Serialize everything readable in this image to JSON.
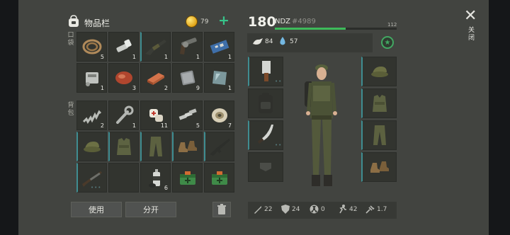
{
  "inventory": {
    "title": "物品栏",
    "coins": "79",
    "add_label": "+",
    "pockets_label": "口袋",
    "backpack_label": "背包",
    "pockets": [
      {
        "icon": "rope-icon",
        "qty": "5"
      },
      {
        "icon": "flashlight-icon",
        "qty": "1"
      },
      {
        "icon": "rifle-icon",
        "qty": "1",
        "equip": true
      },
      {
        "icon": "revolver-icon",
        "qty": "1"
      },
      {
        "icon": "circuit-board-icon",
        "qty": "1"
      },
      {
        "icon": "engine-part-icon",
        "qty": "1"
      },
      {
        "icon": "raw-meat-icon",
        "qty": "3"
      },
      {
        "icon": "copper-ingot-icon",
        "qty": "2"
      },
      {
        "icon": "steel-plate-icon",
        "qty": "9"
      },
      {
        "icon": "glass-pane-icon",
        "qty": "1"
      }
    ],
    "backpack": [
      {
        "icon": "spring-icon",
        "qty": "2"
      },
      {
        "icon": "wrench-icon",
        "qty": "1"
      },
      {
        "icon": "bandage-icon",
        "qty": "11"
      },
      {
        "icon": "metal-bars-icon",
        "qty": "5"
      },
      {
        "icon": "wire-spool-icon",
        "qty": "7"
      },
      {
        "icon": "camo-cap-icon",
        "qty": "",
        "equip": true
      },
      {
        "icon": "vest-icon",
        "qty": "",
        "equip": true
      },
      {
        "icon": "pants-icon",
        "qty": "",
        "equip": true
      },
      {
        "icon": "boots-icon",
        "qty": "",
        "equip": true
      },
      {
        "icon": "assault-rifle-icon",
        "qty": "",
        "equip": true
      },
      {
        "icon": "shotgun-icon",
        "qty": "",
        "equip": true,
        "dots": "•••"
      },
      {
        "icon": "empty-slot-icon",
        "qty": ""
      },
      {
        "icon": "spray-can-icon",
        "qty": "6"
      },
      {
        "icon": "medkit-box-icon",
        "qty": ""
      },
      {
        "icon": "medkit-box-icon",
        "qty": ""
      }
    ],
    "use_label": "使用",
    "split_label": "分开"
  },
  "character": {
    "level": "180",
    "name": "NDZ",
    "id": "#4989",
    "xp_value": "112",
    "xp_fraction": 0.58,
    "hunger": "84",
    "thirst": "57",
    "stats": {
      "attack": "22",
      "defense": "24",
      "radiation": "0",
      "speed": "42",
      "weight": "1.7"
    }
  },
  "close_label": "关闭",
  "colors": {
    "accent": "#3f8d91",
    "xp_green": "#3dbb5a",
    "plus_green": "#37c48a"
  }
}
